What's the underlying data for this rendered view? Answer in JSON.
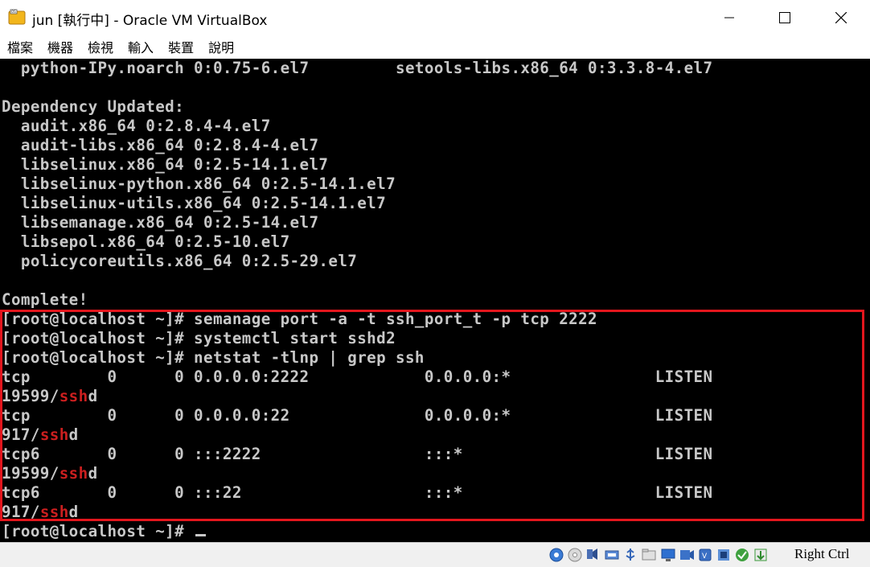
{
  "window": {
    "title": "jun [執行中] - Oracle VM VirtualBox"
  },
  "menu": [
    "檔案",
    "機器",
    "檢視",
    "輸入",
    "裝置",
    "說明"
  ],
  "terminal": {
    "lines": [
      "  python-IPy.noarch 0:0.75-6.el7         setools-libs.x86_64 0:3.3.8-4.el7",
      "",
      "Dependency Updated:",
      "  audit.x86_64 0:2.8.4-4.el7",
      "  audit-libs.x86_64 0:2.8.4-4.el7",
      "  libselinux.x86_64 0:2.5-14.1.el7",
      "  libselinux-python.x86_64 0:2.5-14.1.el7",
      "  libselinux-utils.x86_64 0:2.5-14.1.el7",
      "  libsemanage.x86_64 0:2.5-14.el7",
      "  libsepol.x86_64 0:2.5-10.el7",
      "  policycoreutils.x86_64 0:2.5-29.el7",
      "",
      "Complete!",
      "[root@localhost ~]# semanage port -a -t ssh_port_t -p tcp 2222",
      "[root@localhost ~]# systemctl start sshd2",
      "[root@localhost ~]# netstat -tlnp | grep ssh",
      "tcp        0      0 0.0.0.0:2222            0.0.0.0:*               LISTEN",
      "19599/sshd",
      "tcp        0      0 0.0.0.0:22              0.0.0.0:*               LISTEN",
      "917/sshd",
      "tcp6       0      0 :::2222                 :::*                    LISTEN",
      "19599/sshd",
      "tcp6       0      0 :::22                   :::*                    LISTEN",
      "917/sshd",
      "[root@localhost ~]# "
    ],
    "highlight_word": "ssh",
    "highlight_color": "#cc1f1f",
    "text_color": "#c8c8c8",
    "background": "#000000"
  },
  "annotation": {
    "color": "#e3161d"
  },
  "statusbar": {
    "icons": [
      "hard-disk-icon",
      "optical-drive-icon",
      "audio-icon",
      "network-icon",
      "usb-icon",
      "shared-folders-icon",
      "display-icon",
      "recording-icon",
      "cpu-icon",
      "vt-x-icon",
      "guest-additions-icon",
      "mouse-integration-icon"
    ],
    "host_key": "Right Ctrl"
  }
}
